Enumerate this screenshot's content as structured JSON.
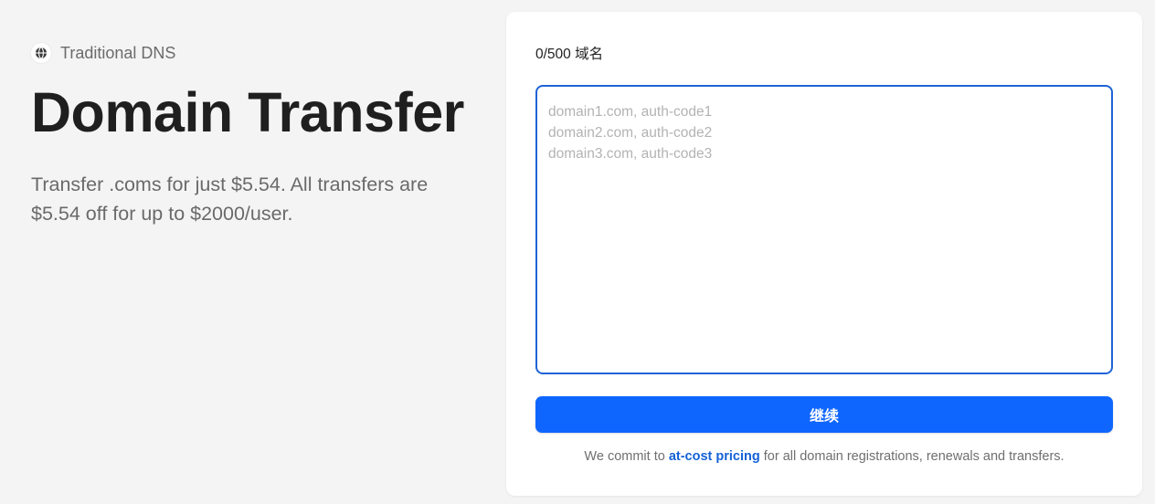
{
  "intro": {
    "eyebrow_icon": "globe-icon",
    "eyebrow_label": "Traditional DNS",
    "title": "Domain Transfer",
    "subtitle": "Transfer .coms for just $5.54. All transfers are $5.54 off for up to $2000/user."
  },
  "form": {
    "counter": "0/500 域名",
    "input_value": "",
    "input_placeholder": "domain1.com, auth-code1\ndomain2.com, auth-code2\ndomain3.com, auth-code3",
    "continue_label": "继续"
  },
  "footer": {
    "commit_prefix": "We commit to ",
    "commit_link": "at-cost pricing",
    "commit_suffix": " for all domain registrations, renewals and transfers."
  },
  "colors": {
    "accent": "#0f66ff",
    "input_border": "#1f63d6",
    "link": "#1562d6",
    "background": "#f4f4f4"
  }
}
